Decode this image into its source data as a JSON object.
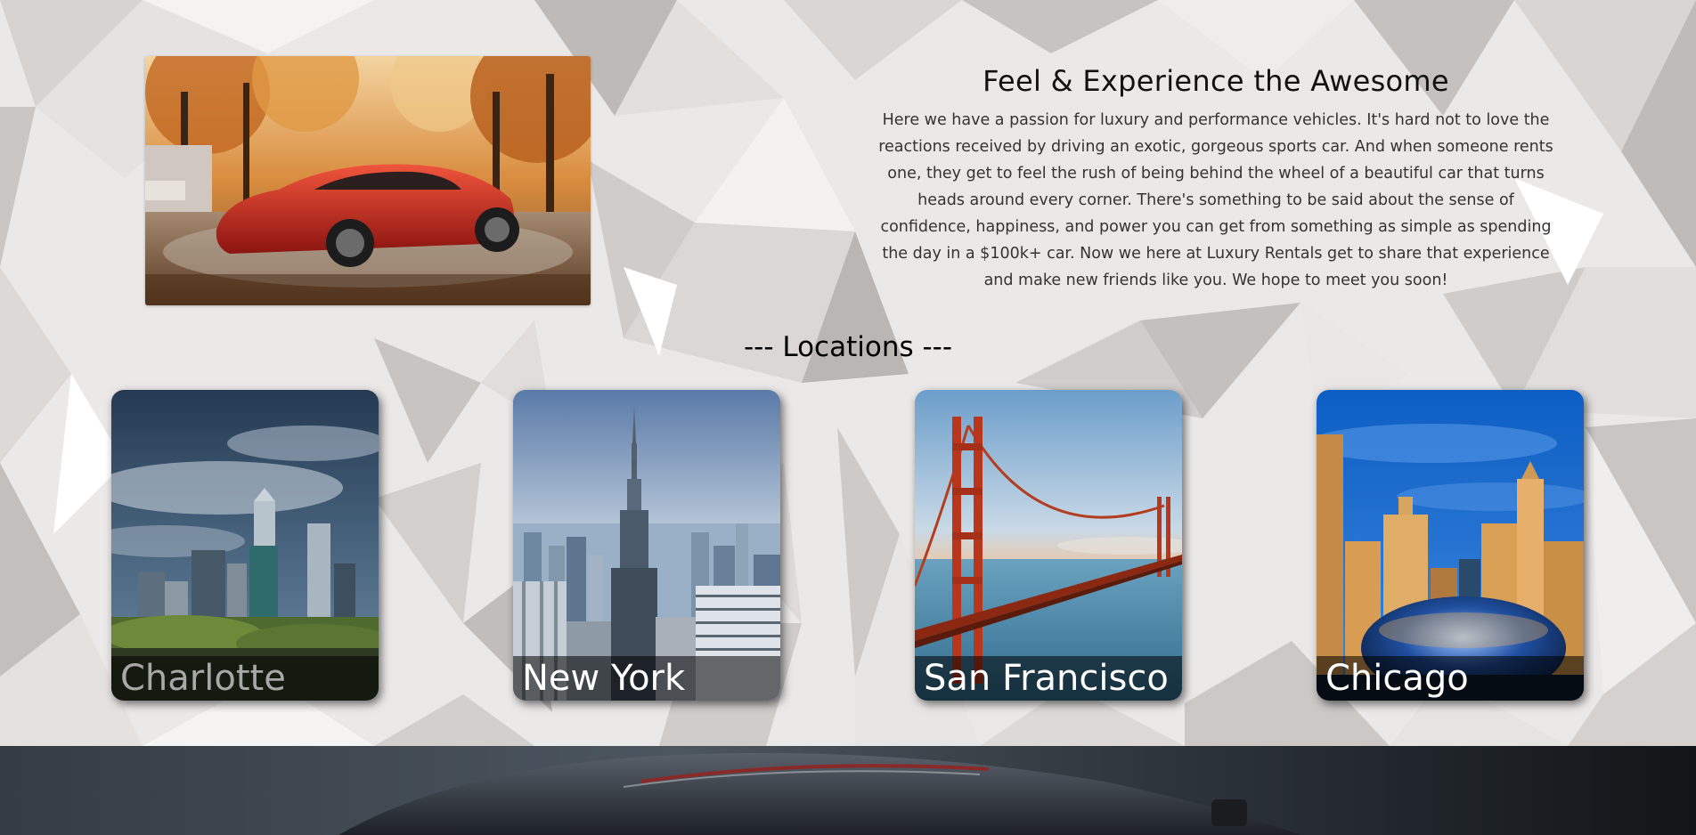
{
  "about": {
    "heading": "Feel & Experience the Awesome",
    "body": "Here we have a passion for luxury and performance vehicles. It's hard not to love the reactions received by driving an exotic, gorgeous sports car. And when someone rents one, they get to feel the rush of being behind the wheel of a beautiful car that turns heads around every corner. There's something to be said about the sense of confidence, happiness, and power you can get from something as simple as spending the day in a $100k+ car. Now we here at Luxury Rentals get to share that experience and make new friends like you. We hope to meet you soon!"
  },
  "locations": {
    "title": "--- Locations ---",
    "items": [
      {
        "name": "Charlotte"
      },
      {
        "name": "New York"
      },
      {
        "name": "San Francisco"
      },
      {
        "name": "Chicago"
      }
    ]
  },
  "colors": {
    "accent_line": "#2f6e6c",
    "caption_bg": "rgba(0,0,0,0.55)"
  }
}
